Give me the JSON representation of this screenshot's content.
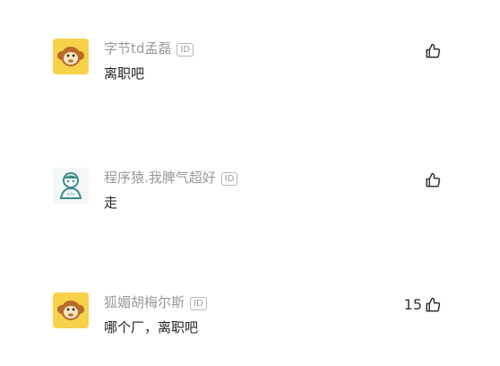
{
  "comments": [
    {
      "username": "字节td孟磊",
      "badge": "ID",
      "text": "离职吧",
      "likes": "",
      "avatar": "monkey-avatar"
    },
    {
      "username": "程序猿.我脾气超好",
      "badge": "ID",
      "text": "走",
      "likes": "",
      "avatar": "programmer-avatar"
    },
    {
      "username": "狐媚胡梅尔斯",
      "badge": "ID",
      "text": "哪个厂，离职吧",
      "likes": "15",
      "avatar": "monkey-avatar"
    }
  ],
  "colors": {
    "username": "#9a9a9a",
    "text": "#222222",
    "avatar_bg": "#f6d24a"
  }
}
